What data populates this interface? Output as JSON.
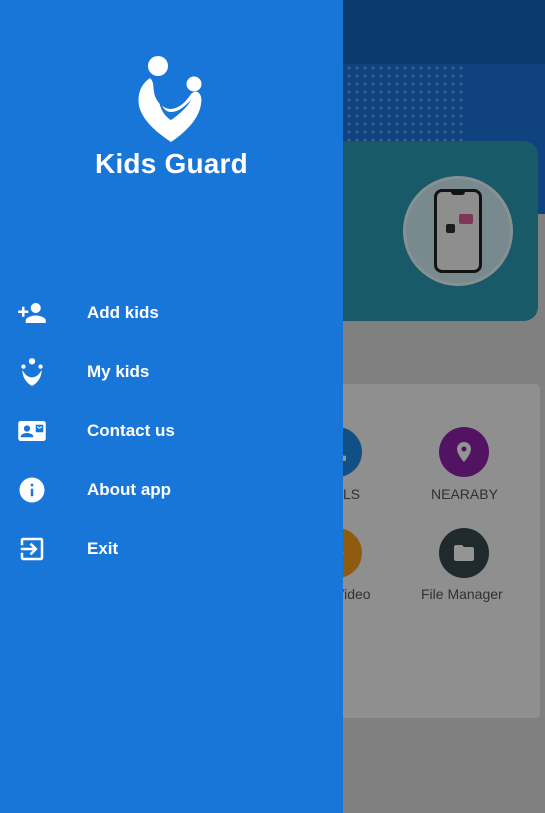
{
  "drawer": {
    "app_title": "Kids Guard",
    "menu": [
      {
        "label": "Add kids",
        "icon": "person-add-icon"
      },
      {
        "label": "My kids",
        "icon": "kids-logo-icon"
      },
      {
        "label": "Contact us",
        "icon": "contact-card-icon"
      },
      {
        "label": "About app",
        "icon": "info-icon"
      },
      {
        "label": "Exit",
        "icon": "exit-icon"
      }
    ]
  },
  "background": {
    "features": [
      {
        "label": "LS",
        "icon": "call-icon",
        "color": "#1e88e5"
      },
      {
        "label": "NEARABY",
        "icon": "location-pin-icon",
        "color": "#8e24aa"
      },
      {
        "label": "Video",
        "icon": "video-icon",
        "color": "#f59e1b"
      },
      {
        "label": "File Manager",
        "icon": "folder-icon",
        "color": "#37474f"
      }
    ]
  },
  "colors": {
    "drawer_bg": "#1976d9",
    "drawer_text": "#ffffff"
  }
}
